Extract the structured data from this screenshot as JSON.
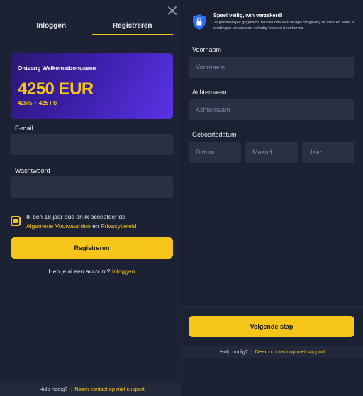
{
  "left": {
    "tabs": {
      "login": "Inloggen",
      "register": "Registreren"
    },
    "promo": {
      "subtitle": "Ontvang Welkomstbonussen",
      "amount": "4250 EUR",
      "extra": "425% + 425 FS"
    },
    "email": {
      "label": "E-mail",
      "placeholder": ""
    },
    "password": {
      "label": "Wachtwoord",
      "placeholder": ""
    },
    "terms": {
      "prefix": "Ik ben 18 jaar oud en ik accepteer de",
      "link1": "Algemene Voorwaarden",
      "and": "en",
      "link2": "Privacybeleid"
    },
    "submit_label": "Registreren",
    "account": {
      "text": "Heb je al een account?",
      "link": "Inloggen"
    },
    "footer": {
      "help": "Hulp nodig?",
      "contact": "Neem contact op met support"
    }
  },
  "right": {
    "safety": {
      "title": "Speel veilig, win verzekerd!",
      "text": "Je persoonlijke gegevens helpen ons een veilige omgeving te creëren waar je stortingen en winsten volledig worden beschermd."
    },
    "first_name": {
      "label": "Voornaam",
      "placeholder": "Voornaam"
    },
    "last_name": {
      "label": "Achternaam",
      "placeholder": "Achternaam"
    },
    "birthdate": {
      "label": "Geboortedatum",
      "day": "Datum",
      "month": "Maand",
      "year": "Jaar"
    },
    "next_label": "Volgende stap",
    "footer": {
      "help": "Hulp nodig?",
      "contact": "Neem contact op met support"
    }
  },
  "colors": {
    "accent": "#f5c518",
    "background": "#1c2033",
    "input": "#2a2f44",
    "promo": "#3b1fa8"
  },
  "icons": {
    "close": "close-icon",
    "shield": "shield-lock-icon"
  }
}
